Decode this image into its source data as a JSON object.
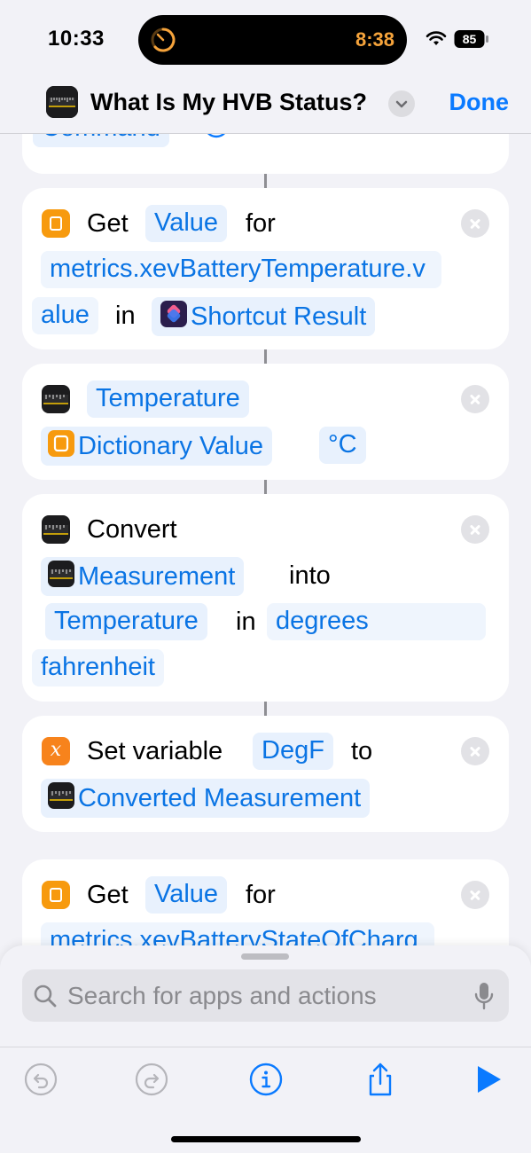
{
  "status_bar": {
    "time": "10:33",
    "timer": "8:38",
    "battery": "85"
  },
  "nav": {
    "title": "What Is My HVB Status?",
    "done_label": "Done"
  },
  "cards": {
    "run_command": {
      "token": "Command"
    },
    "get_value_1": {
      "verb": "Get",
      "key_token": "Value",
      "for_text": "for",
      "path_line1": "metrics.xevBatteryTemperature.v",
      "path_line2": "alue",
      "in_text": "in",
      "source_token": "Shortcut Result"
    },
    "temperature": {
      "unit_type_token": "Temperature",
      "value_token": "Dictionary Value",
      "unit_token": "°C"
    },
    "convert": {
      "verb": "Convert",
      "input_token": "Measurement",
      "into_text": "into",
      "type_token": "Temperature",
      "in_text": "in",
      "unit_line1": "degrees",
      "unit_line2": "fahrenheit"
    },
    "set_variable": {
      "verb": "Set variable",
      "var_token": "DegF",
      "to_text": "to",
      "value_token": "Converted Measurement"
    },
    "get_value_2": {
      "verb": "Get",
      "key_token": "Value",
      "for_text": "for",
      "path_partial": "metrics.xevBatteryStateOfCharg"
    }
  },
  "search": {
    "placeholder": "Search for apps and actions"
  },
  "toolbar": {
    "icons": [
      "undo-icon",
      "redo-icon",
      "info-icon",
      "share-icon",
      "play-icon"
    ]
  },
  "colors": {
    "accent": "#0A7AFF",
    "token_bg": "#E8F1FD",
    "orange": "#F79A0E",
    "timer": "#F5A33B"
  }
}
